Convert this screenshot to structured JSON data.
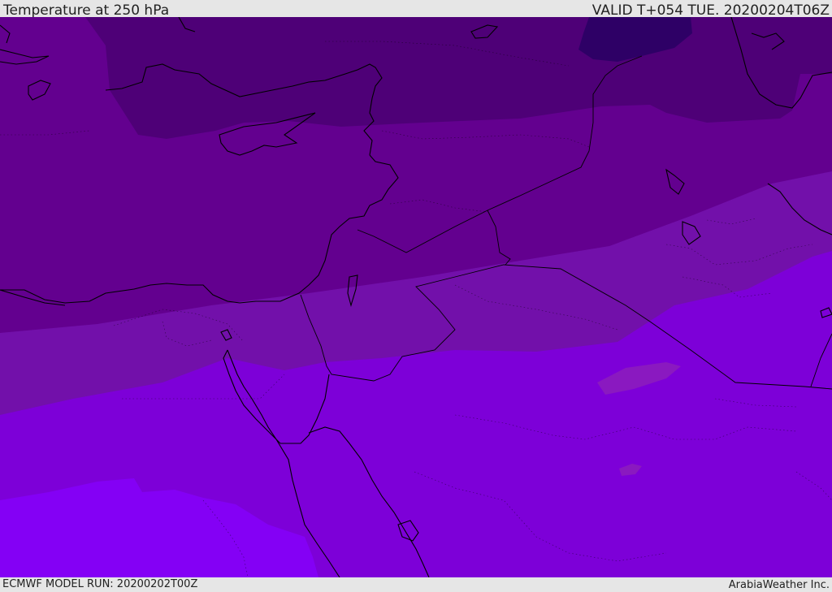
{
  "header": {
    "title": "Temperature at 250 hPa",
    "valid": "VALID T+054 TUE. 20200204T06Z"
  },
  "footer": {
    "model_run": "ECMWF MODEL RUN: 20200202T00Z",
    "credit": "ArabiaWeather Inc."
  },
  "colors": {
    "coldest": "#2e0066",
    "band_1": "#4e0077",
    "band_2": "#63008f",
    "band_3": "#7210aa",
    "band_4": "#7d00d8",
    "band_5": "#8400f5",
    "warm_patch": "#8a19c0",
    "coastline": "#000000"
  }
}
